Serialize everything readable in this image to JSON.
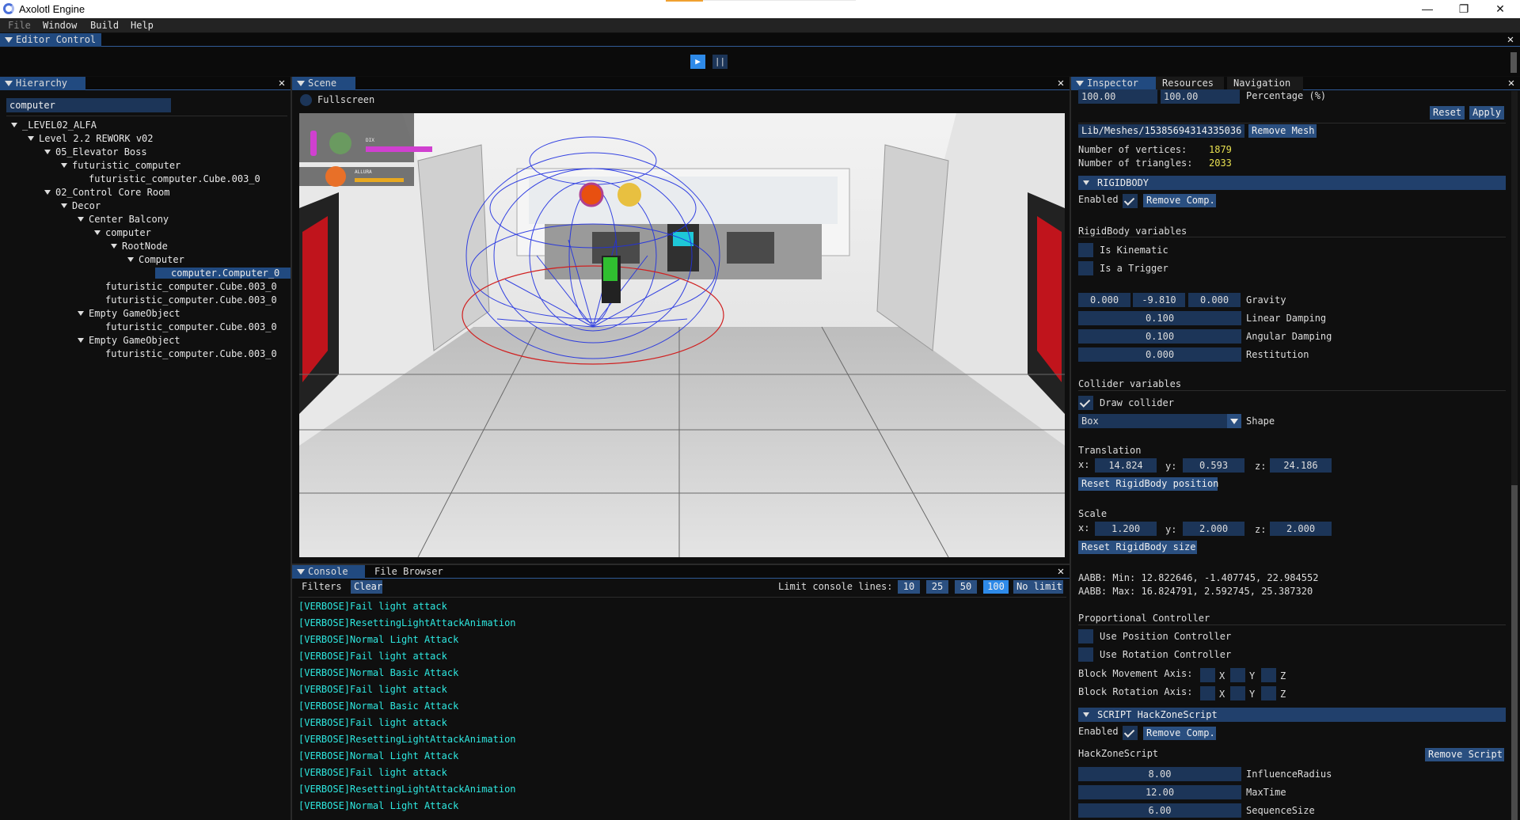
{
  "window": {
    "title": "Axolotl Engine",
    "controls": [
      "—",
      "❐",
      "✕"
    ]
  },
  "menu": [
    "File",
    "Window",
    "Build",
    "Help"
  ],
  "editor_control": {
    "tab": "Editor Control",
    "play_label": "▶",
    "pause_label": "||"
  },
  "hierarchy": {
    "tab": "Hierarchy",
    "search_value": "computer",
    "items": [
      {
        "label": "_LEVEL02_ALFA",
        "arrow": true
      },
      {
        "label": "Level 2.2 REWORK v02",
        "arrow": true
      },
      {
        "label": "05_Elevator Boss",
        "arrow": true
      },
      {
        "label": "futuristic_computer",
        "arrow": true
      },
      {
        "label": "futuristic_computer.Cube.003_0",
        "arrow": false
      },
      {
        "label": "02_Control Core Room",
        "arrow": true
      },
      {
        "label": "Decor",
        "arrow": true
      },
      {
        "label": "Center Balcony",
        "arrow": true
      },
      {
        "label": "computer",
        "arrow": true
      },
      {
        "label": "RootNode",
        "arrow": true
      },
      {
        "label": "Computer",
        "arrow": true
      },
      {
        "label": "computer.Computer_0",
        "arrow": false
      },
      {
        "label": "futuristic_computer.Cube.003_0",
        "arrow": false
      },
      {
        "label": "futuristic_computer.Cube.003_0",
        "arrow": false
      },
      {
        "label": "Empty GameObject",
        "arrow": true
      },
      {
        "label": "futuristic_computer.Cube.003_0",
        "arrow": false
      },
      {
        "label": "Empty GameObject",
        "arrow": true
      },
      {
        "label": "futuristic_computer.Cube.003_0",
        "arrow": false
      }
    ]
  },
  "scene": {
    "tab": "Scene",
    "fullscreen_label": "Fullscreen",
    "hud": {
      "player1": "DIX",
      "player2": "ALLURA"
    }
  },
  "console": {
    "tabs": [
      "Console",
      "File Browser"
    ],
    "filters_label": "Filters",
    "clear_label": "Clear",
    "limit_label": "Limit console lines:",
    "limit_options": [
      "10",
      "25",
      "50",
      "100",
      "No limit"
    ],
    "limit_selected": "100",
    "lines": [
      "[VERBOSE]Fail light attack",
      "[VERBOSE]ResettingLightAttackAnimation",
      "[VERBOSE]Normal Light Attack",
      "[VERBOSE]Fail light attack",
      "[VERBOSE]Normal Basic Attack",
      "[VERBOSE]Fail light attack",
      "[VERBOSE]Normal Basic Attack",
      "[VERBOSE]Fail light attack",
      "[VERBOSE]ResettingLightAttackAnimation",
      "[VERBOSE]Normal Light Attack",
      "[VERBOSE]Fail light attack",
      "[VERBOSE]ResettingLightAttackAnimation",
      "[VERBOSE]Normal Light Attack"
    ]
  },
  "inspector": {
    "tabs": [
      "Inspector",
      "Resources",
      "Navigation"
    ],
    "top_fields": [
      "100.00",
      "100.00"
    ],
    "percentage_label": "Percentage (%)",
    "reset_label": "Reset",
    "apply_label": "Apply",
    "mesh_path": "Lib/Meshes/15385694314335036",
    "remove_mesh_label": "Remove Mesh",
    "vertices_label": "Number of vertices:",
    "vertices_value": "1879",
    "triangles_label": "Number of triangles:",
    "triangles_value": "2033",
    "rigidbody": {
      "header": "RIGIDBODY",
      "enabled_label": "Enabled",
      "remove_comp_label": "Remove Comp.",
      "vars_label": "RigidBody variables",
      "is_kinematic_label": "Is Kinematic",
      "is_trigger_label": "Is a Trigger",
      "gravity": [
        "0.000",
        "-9.810",
        "0.000"
      ],
      "gravity_label": "Gravity",
      "linear_damping": "0.100",
      "linear_damping_label": "Linear Damping",
      "angular_damping": "0.100",
      "angular_damping_label": "Angular Damping",
      "restitution": "0.000",
      "restitution_label": "Restitution",
      "collider_label": "Collider variables",
      "draw_collider_label": "Draw collider",
      "shape_value": "Box",
      "shape_label": "Shape",
      "translation_label": "Translation",
      "translation": {
        "x": "14.824",
        "y": "0.593",
        "z": "24.186"
      },
      "reset_position_label": "Reset RigidBody position",
      "scale_label": "Scale",
      "scale": {
        "x": "1.200",
        "y": "2.000",
        "z": "2.000"
      },
      "reset_size_label": "Reset RigidBody size",
      "aabb_min": "AABB: Min: 12.822646, -1.407745, 22.984552",
      "aabb_max": "AABB: Max: 16.824791, 2.592745, 25.387320",
      "prop_controller_label": "Proportional Controller",
      "use_position_label": "Use Position Controller",
      "use_rotation_label": "Use Rotation Controller",
      "block_movement_label": "Block Movement Axis:",
      "block_rotation_label": "Block Rotation Axis:",
      "axes": [
        "X",
        "Y",
        "Z"
      ],
      "x_label": "x:",
      "y_label": "y:",
      "z_label": "z:"
    },
    "script": {
      "header": "SCRIPT HackZoneScript",
      "enabled_label": "Enabled",
      "remove_comp_label": "Remove Comp.",
      "name_label": "HackZoneScript",
      "remove_script_label": "Remove Script",
      "influence_radius": "8.00",
      "influence_radius_label": "InfluenceRadius",
      "max_time": "12.00",
      "max_time_label": "MaxTime",
      "sequence_size": "6.00",
      "sequence_size_label": "SequenceSize"
    }
  },
  "colors": {
    "accent": "#214a80",
    "console_text": "#2ee8e0",
    "button": "#2a4f80",
    "highlight_button": "#2e8ae8",
    "stat_value": "#e8e050"
  }
}
